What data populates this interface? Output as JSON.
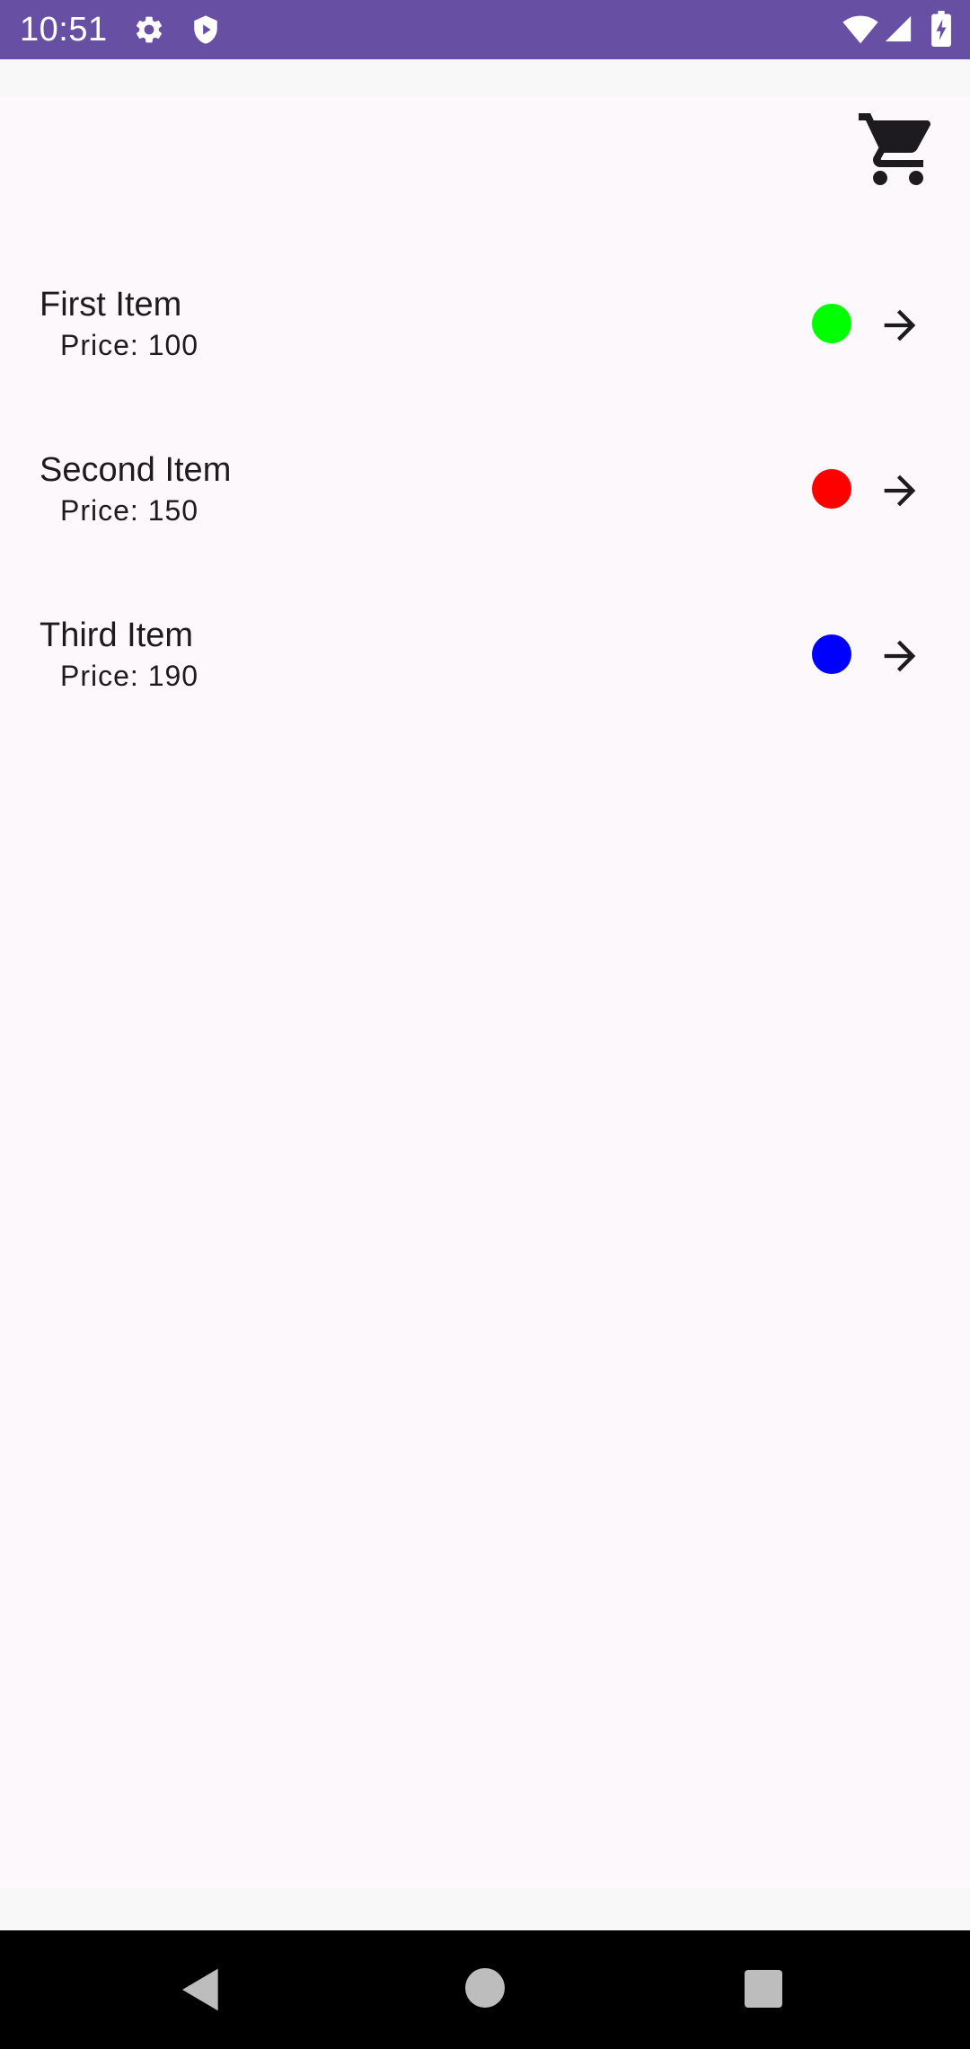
{
  "status_bar": {
    "time": "10:51",
    "icons": [
      "settings-icon",
      "shield-icon",
      "wifi-icon",
      "signal-icon",
      "battery-charging-icon"
    ],
    "background_color": "#6750a4"
  },
  "toolbar": {
    "cart_icon": "shopping-cart-icon"
  },
  "items": [
    {
      "name": "First Item",
      "price": "Price: 100",
      "color": "#00ff00",
      "action_icon": "arrow-forward-icon"
    },
    {
      "name": "Second Item",
      "price": "Price: 150",
      "color": "#ff0000",
      "action_icon": "arrow-forward-icon"
    },
    {
      "name": "Third Item",
      "price": "Price: 190",
      "color": "#0000ff",
      "action_icon": "arrow-forward-icon"
    }
  ],
  "nav_bar": {
    "buttons": [
      "back-icon",
      "home-icon",
      "recents-icon"
    ]
  }
}
